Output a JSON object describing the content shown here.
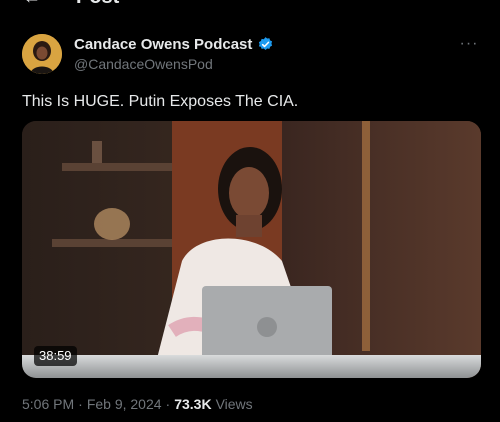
{
  "header": {
    "back_icon": "arrow-left-icon",
    "title": "Post"
  },
  "author": {
    "name": "Candace Owens Podcast",
    "handle": "@CandaceOwensPod",
    "verified_icon": "verified-badge-icon",
    "verified_color": "#1d9bf0",
    "avatar_color": "#d9a441"
  },
  "more_icon": "more-horizontal-icon",
  "more_label": "···",
  "tweet": {
    "text": "This Is HUGE. Putin Exposes The CIA."
  },
  "media": {
    "type": "video",
    "duration": "38:59"
  },
  "meta": {
    "time": "5:06 PM",
    "separator1": "·",
    "date": "Feb 9, 2024",
    "separator2": "·",
    "views_count": "73.3K",
    "views_label": "Views"
  }
}
